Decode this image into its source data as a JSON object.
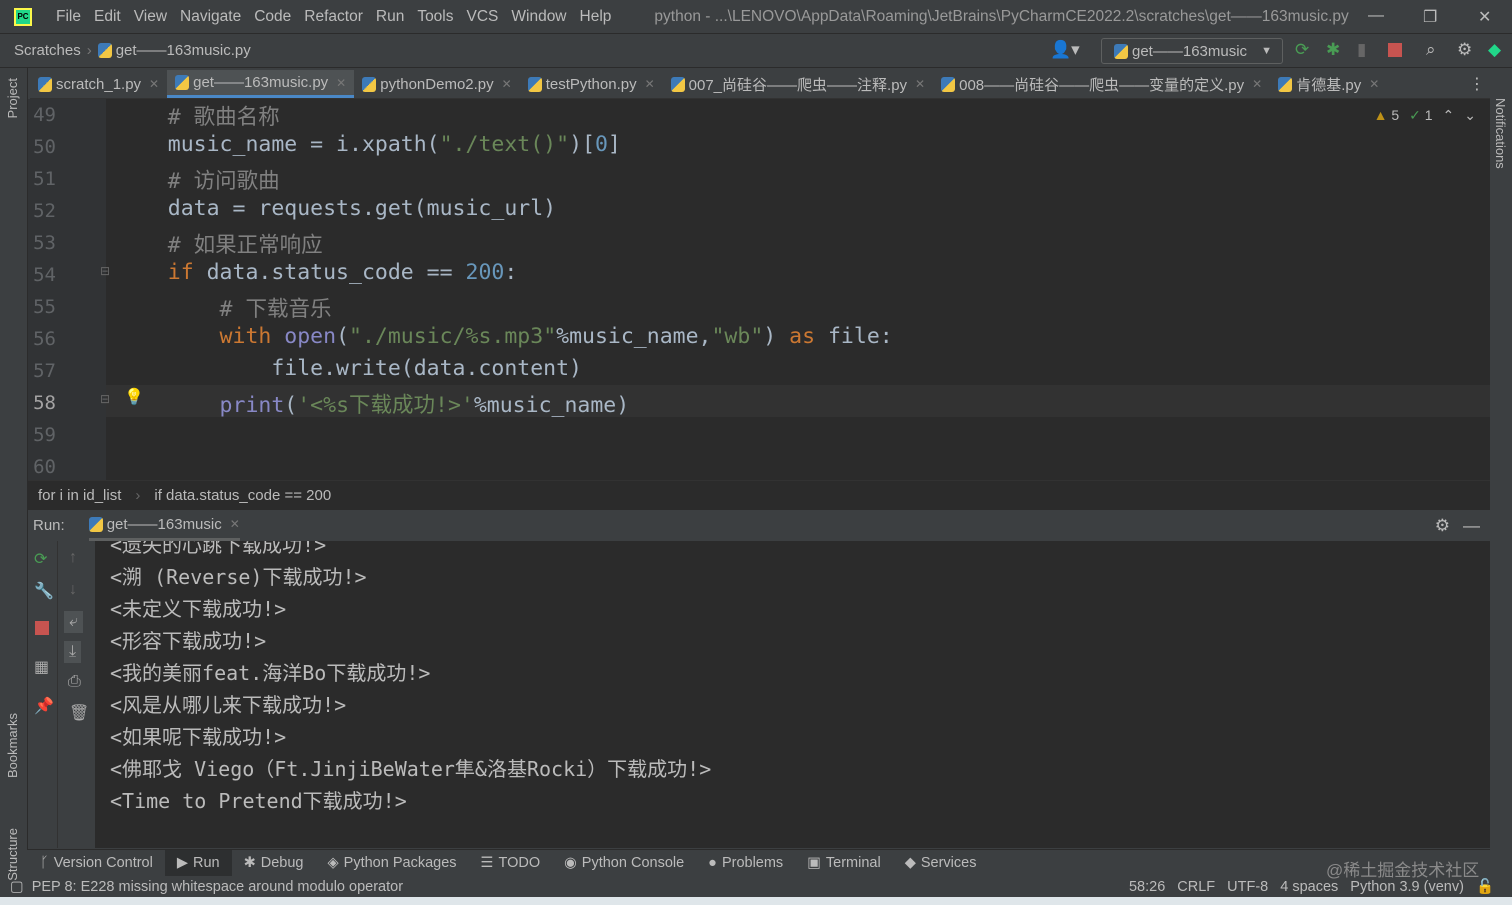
{
  "menubar": {
    "items": [
      "File",
      "Edit",
      "View",
      "Navigate",
      "Code",
      "Refactor",
      "Run",
      "Tools",
      "VCS",
      "Window",
      "Help"
    ],
    "title": "python - ...\\LENOVO\\AppData\\Roaming\\JetBrains\\PyCharmCE2022.2\\scratches\\get——163music.py",
    "logo": "PC"
  },
  "navbar": {
    "root": "Scratches",
    "file": "get——163music.py",
    "run_config": "get——163music"
  },
  "tabs": [
    {
      "label": "scratch_1.py",
      "active": false
    },
    {
      "label": "get——163music.py",
      "active": true
    },
    {
      "label": "pythonDemo2.py",
      "active": false
    },
    {
      "label": "testPython.py",
      "active": false
    },
    {
      "label": "007_尚硅谷——爬虫——注释.py",
      "active": false
    },
    {
      "label": "008——尚硅谷——爬虫——变量的定义.py",
      "active": false
    },
    {
      "label": "肯德基.py",
      "active": false
    }
  ],
  "side": {
    "project": "Project",
    "bookmarks": "Bookmarks",
    "structure": "Structure",
    "notifications": "Notifications"
  },
  "inspections": {
    "warnings": "5",
    "typos": "1"
  },
  "editor": {
    "current_line": 58,
    "lines": [
      {
        "n": 49,
        "seg": [
          [
            "cm",
            "    # 歌曲名称"
          ]
        ]
      },
      {
        "n": 50,
        "seg": [
          [
            "",
            "    music_name = i.xpath("
          ],
          [
            "str",
            "\"./text()\""
          ],
          [
            "",
            ")["
          ],
          [
            "num",
            "0"
          ],
          [
            "",
            "]"
          ]
        ]
      },
      {
        "n": 51,
        "seg": [
          [
            "cm",
            "    # 访问歌曲"
          ]
        ]
      },
      {
        "n": 52,
        "seg": [
          [
            "",
            "    data = requests.get(music_url)"
          ]
        ]
      },
      {
        "n": 53,
        "seg": [
          [
            "cm",
            "    # 如果正常响应"
          ]
        ]
      },
      {
        "n": 54,
        "seg": [
          [
            "kw",
            "    if"
          ],
          [
            "",
            " data.status_code == "
          ],
          [
            "num",
            "200"
          ],
          [
            "",
            ":"
          ]
        ]
      },
      {
        "n": 55,
        "seg": [
          [
            "cm",
            "        # 下载音乐"
          ]
        ]
      },
      {
        "n": 56,
        "seg": [
          [
            "kw",
            "        with"
          ],
          [
            "",
            " "
          ],
          [
            "bi",
            "open"
          ],
          [
            "",
            "("
          ],
          [
            "str",
            "\"./music/%s.mp3\""
          ],
          [
            "",
            "%music_name,"
          ],
          [
            "str",
            "\"wb\""
          ],
          [
            "",
            ") "
          ],
          [
            "kw",
            "as"
          ],
          [
            "",
            " file:"
          ]
        ]
      },
      {
        "n": 57,
        "seg": [
          [
            "",
            "            file.write(data.content)"
          ]
        ]
      },
      {
        "n": 58,
        "seg": [
          [
            "bi",
            "        print"
          ],
          [
            "",
            "("
          ],
          [
            "str",
            "'<%s下载成功!>'"
          ],
          [
            "",
            "%music_name)"
          ]
        ]
      },
      {
        "n": 59,
        "seg": []
      },
      {
        "n": 60,
        "seg": []
      }
    ]
  },
  "breadcrumbs": [
    "for i in id_list",
    "if data.status_code == 200"
  ],
  "run": {
    "label": "Run:",
    "tab": "get——163music",
    "output": [
      "<遗失的心跳下载成功!>",
      "<溯 (Reverse)下载成功!>",
      "<未定义下载成功!>",
      "<形容下载成功!>",
      "<我的美丽feat.海洋Bo下载成功!>",
      "<风是从哪儿来下载成功!>",
      "<如果呢下载成功!>",
      "<佛耶戈 Viego（Ft.JinjiBeWater隼&洛基Rocki）下载成功!>",
      "<Time to Pretend下载成功!>"
    ]
  },
  "toolwindows": [
    {
      "label": "Version Control",
      "icon": "branch-icon",
      "active": false
    },
    {
      "label": "Run",
      "icon": "play-icon",
      "active": true
    },
    {
      "label": "Debug",
      "icon": "bug-icon",
      "active": false
    },
    {
      "label": "Python Packages",
      "icon": "packages-icon",
      "active": false
    },
    {
      "label": "TODO",
      "icon": "list-icon",
      "active": false
    },
    {
      "label": "Python Console",
      "icon": "python-icon",
      "active": false
    },
    {
      "label": "Problems",
      "icon": "problems-icon",
      "active": false
    },
    {
      "label": "Terminal",
      "icon": "terminal-icon",
      "active": false
    },
    {
      "label": "Services",
      "icon": "services-icon",
      "active": false
    }
  ],
  "status": {
    "message": "PEP 8: E228 missing whitespace around modulo operator",
    "position": "58:26",
    "line_sep": "CRLF",
    "encoding": "UTF-8",
    "indent": "4 spaces",
    "interpreter": "Python 3.9 (venv)"
  },
  "watermark": "@稀土掘金技术社区",
  "colors": {
    "editor_bg": "#2b2b2b",
    "chrome_bg": "#3c3f41",
    "keyword": "#cc7832",
    "string": "#6a8759",
    "comment": "#808080",
    "number": "#6897bb",
    "builtin": "#8888c6",
    "stop": "#c75450",
    "run_green": "#499c54"
  }
}
